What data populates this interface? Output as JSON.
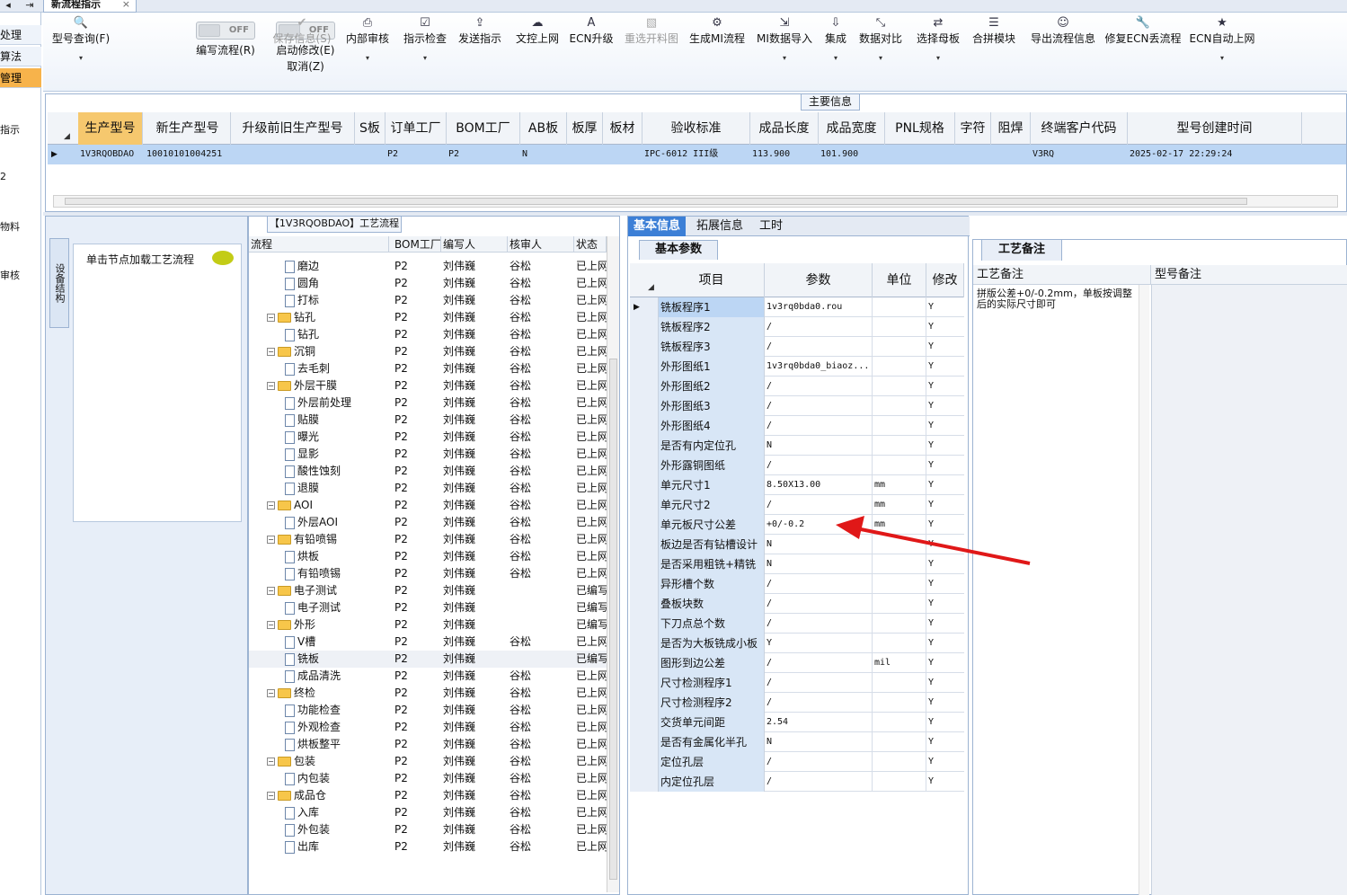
{
  "tabbar": {
    "nav_left": "◂",
    "nav_right": "⇥",
    "doc_tab": "新流程指示",
    "close": "×"
  },
  "leftnav": {
    "items": [
      {
        "label": "处理"
      },
      {
        "label": "算法"
      },
      {
        "label": "管理",
        "selected": true
      }
    ],
    "fragments": [
      "指示",
      "2",
      "物料",
      "审核"
    ]
  },
  "ribbon": {
    "buttons": [
      {
        "label": "型号查询(F)",
        "icon": "search-icon",
        "glyph": "🔍",
        "dropdown": true,
        "enabled": true
      },
      {
        "label": "保存信息(S)",
        "icon": "check-icon",
        "glyph": "✔",
        "dropdown": false,
        "enabled": false
      },
      {
        "label": "内部审核",
        "icon": "printer-icon",
        "glyph": "⎙",
        "dropdown": true,
        "enabled": true
      },
      {
        "label": "指示检查",
        "icon": "checkbox-icon",
        "glyph": "☑",
        "dropdown": true,
        "enabled": true
      },
      {
        "label": "发送指示",
        "icon": "upload-icon",
        "glyph": "⇪",
        "dropdown": false,
        "enabled": true
      },
      {
        "label": "文控上网",
        "icon": "cloud-upload-icon",
        "glyph": "☁",
        "dropdown": false,
        "enabled": true
      },
      {
        "label": "ECN升级",
        "icon": "font-icon",
        "glyph": "A",
        "dropdown": false,
        "enabled": true
      },
      {
        "label": "重选开料图",
        "icon": "image-icon",
        "glyph": "▧",
        "dropdown": false,
        "enabled": false
      },
      {
        "label": "生成MI流程",
        "icon": "cogs-icon",
        "glyph": "⚙",
        "dropdown": false,
        "enabled": true
      },
      {
        "label": "MI数据导入",
        "icon": "sign-in-icon",
        "glyph": "⇲",
        "dropdown": true,
        "enabled": true
      },
      {
        "label": "集成",
        "icon": "download-icon",
        "glyph": "⇩",
        "dropdown": true,
        "enabled": true
      },
      {
        "label": "数据对比",
        "icon": "compress-icon",
        "glyph": "⤡",
        "dropdown": true,
        "enabled": true
      },
      {
        "label": "选择母板",
        "icon": "shuffle-icon",
        "glyph": "⇄",
        "dropdown": true,
        "enabled": true
      },
      {
        "label": "合拼模块",
        "icon": "list-icon",
        "glyph": "☰",
        "dropdown": false,
        "enabled": true
      },
      {
        "label": "导出流程信息",
        "icon": "smile-icon",
        "glyph": "☺",
        "dropdown": false,
        "enabled": true
      },
      {
        "label": "修复ECN丢流程",
        "icon": "wrench-icon",
        "glyph": "🔧",
        "dropdown": false,
        "enabled": true
      },
      {
        "label": "ECN自动上网",
        "icon": "star-icon",
        "glyph": "★",
        "dropdown": true,
        "enabled": true
      }
    ],
    "toggle1": {
      "state": "OFF",
      "label": "编写流程(R)"
    },
    "toggle2": {
      "state": "OFF",
      "label": "启动修改(E)",
      "label2": "取消(Z)"
    }
  },
  "main_info": {
    "title": "主要信息",
    "columns": [
      "生产型号",
      "新生产型号",
      "升级前旧生产型号",
      "S板",
      "订单工厂",
      "BOM工厂",
      "AB板",
      "板厚",
      "板材",
      "验收标准",
      "成品长度",
      "成品宽度",
      "PNL规格",
      "字符",
      "阻焊",
      "终端客户代码",
      "型号创建时间"
    ],
    "row": [
      "1V3RQOBDAO",
      "10010101004251",
      "",
      "",
      "P2",
      "P2",
      "N",
      "",
      "",
      "IPC-6012 III级",
      "113.900",
      "101.900",
      "",
      "",
      "",
      "V3RQ",
      "2025-02-17 22:29:24"
    ]
  },
  "left_panel": {
    "vtab": "设备结构",
    "hint": "单击节点加载工艺流程"
  },
  "process": {
    "title": "【1V3RQOBDAO】工艺流程",
    "columns": [
      "流程",
      "BOM工厂",
      "编写人",
      "核审人",
      "状态"
    ],
    "rows": [
      {
        "name": "磨边",
        "level": 2,
        "type": "file",
        "factory": "P2",
        "writer": "刘伟巍",
        "reviewer": "谷松",
        "status": "已上网"
      },
      {
        "name": "圆角",
        "level": 2,
        "type": "file",
        "factory": "P2",
        "writer": "刘伟巍",
        "reviewer": "谷松",
        "status": "已上网"
      },
      {
        "name": "打标",
        "level": 2,
        "type": "file",
        "factory": "P2",
        "writer": "刘伟巍",
        "reviewer": "谷松",
        "status": "已上网"
      },
      {
        "name": "钻孔",
        "level": 1,
        "type": "folder",
        "factory": "P2",
        "writer": "刘伟巍",
        "reviewer": "谷松",
        "status": "已上网"
      },
      {
        "name": "钻孔",
        "level": 2,
        "type": "file",
        "factory": "P2",
        "writer": "刘伟巍",
        "reviewer": "谷松",
        "status": "已上网"
      },
      {
        "name": "沉铜",
        "level": 1,
        "type": "folder",
        "factory": "P2",
        "writer": "刘伟巍",
        "reviewer": "谷松",
        "status": "已上网"
      },
      {
        "name": "去毛刺",
        "level": 2,
        "type": "file",
        "factory": "P2",
        "writer": "刘伟巍",
        "reviewer": "谷松",
        "status": "已上网"
      },
      {
        "name": "外层干膜",
        "level": 1,
        "type": "folder",
        "factory": "P2",
        "writer": "刘伟巍",
        "reviewer": "谷松",
        "status": "已上网"
      },
      {
        "name": "外层前处理",
        "level": 2,
        "type": "file",
        "factory": "P2",
        "writer": "刘伟巍",
        "reviewer": "谷松",
        "status": "已上网"
      },
      {
        "name": "贴膜",
        "level": 2,
        "type": "file",
        "factory": "P2",
        "writer": "刘伟巍",
        "reviewer": "谷松",
        "status": "已上网"
      },
      {
        "name": "曝光",
        "level": 2,
        "type": "file",
        "factory": "P2",
        "writer": "刘伟巍",
        "reviewer": "谷松",
        "status": "已上网"
      },
      {
        "name": "显影",
        "level": 2,
        "type": "file",
        "factory": "P2",
        "writer": "刘伟巍",
        "reviewer": "谷松",
        "status": "已上网"
      },
      {
        "name": "酸性蚀刻",
        "level": 2,
        "type": "file",
        "factory": "P2",
        "writer": "刘伟巍",
        "reviewer": "谷松",
        "status": "已上网"
      },
      {
        "name": "退膜",
        "level": 2,
        "type": "file",
        "factory": "P2",
        "writer": "刘伟巍",
        "reviewer": "谷松",
        "status": "已上网"
      },
      {
        "name": "AOI",
        "level": 1,
        "type": "folder",
        "factory": "P2",
        "writer": "刘伟巍",
        "reviewer": "谷松",
        "status": "已上网"
      },
      {
        "name": "外层AOI",
        "level": 2,
        "type": "file",
        "factory": "P2",
        "writer": "刘伟巍",
        "reviewer": "谷松",
        "status": "已上网"
      },
      {
        "name": "有铅喷锡",
        "level": 1,
        "type": "folder",
        "factory": "P2",
        "writer": "刘伟巍",
        "reviewer": "谷松",
        "status": "已上网"
      },
      {
        "name": "烘板",
        "level": 2,
        "type": "file",
        "factory": "P2",
        "writer": "刘伟巍",
        "reviewer": "谷松",
        "status": "已上网"
      },
      {
        "name": "有铅喷锡",
        "level": 2,
        "type": "file",
        "factory": "P2",
        "writer": "刘伟巍",
        "reviewer": "谷松",
        "status": "已上网"
      },
      {
        "name": "电子测试",
        "level": 1,
        "type": "folder",
        "factory": "P2",
        "writer": "刘伟巍",
        "reviewer": "",
        "status": "已编写"
      },
      {
        "name": "电子测试",
        "level": 2,
        "type": "file",
        "factory": "P2",
        "writer": "刘伟巍",
        "reviewer": "",
        "status": "已编写"
      },
      {
        "name": "外形",
        "level": 1,
        "type": "folder",
        "factory": "P2",
        "writer": "刘伟巍",
        "reviewer": "",
        "status": "已编写"
      },
      {
        "name": "V槽",
        "level": 2,
        "type": "file",
        "factory": "P2",
        "writer": "刘伟巍",
        "reviewer": "谷松",
        "status": "已上网"
      },
      {
        "name": "铣板",
        "level": 2,
        "type": "file",
        "factory": "P2",
        "writer": "刘伟巍",
        "reviewer": "",
        "status": "已编写",
        "selected": true
      },
      {
        "name": "成品清洗",
        "level": 2,
        "type": "file",
        "factory": "P2",
        "writer": "刘伟巍",
        "reviewer": "谷松",
        "status": "已上网"
      },
      {
        "name": "终检",
        "level": 1,
        "type": "folder",
        "factory": "P2",
        "writer": "刘伟巍",
        "reviewer": "谷松",
        "status": "已上网"
      },
      {
        "name": "功能检查",
        "level": 2,
        "type": "file",
        "factory": "P2",
        "writer": "刘伟巍",
        "reviewer": "谷松",
        "status": "已上网"
      },
      {
        "name": "外观检查",
        "level": 2,
        "type": "file",
        "factory": "P2",
        "writer": "刘伟巍",
        "reviewer": "谷松",
        "status": "已上网"
      },
      {
        "name": "烘板整平",
        "level": 2,
        "type": "file",
        "factory": "P2",
        "writer": "刘伟巍",
        "reviewer": "谷松",
        "status": "已上网"
      },
      {
        "name": "包装",
        "level": 1,
        "type": "folder",
        "factory": "P2",
        "writer": "刘伟巍",
        "reviewer": "谷松",
        "status": "已上网"
      },
      {
        "name": "内包装",
        "level": 2,
        "type": "file",
        "factory": "P2",
        "writer": "刘伟巍",
        "reviewer": "谷松",
        "status": "已上网"
      },
      {
        "name": "成品仓",
        "level": 1,
        "type": "folder",
        "factory": "P2",
        "writer": "刘伟巍",
        "reviewer": "谷松",
        "status": "已上网"
      },
      {
        "name": "入库",
        "level": 2,
        "type": "file",
        "factory": "P2",
        "writer": "刘伟巍",
        "reviewer": "谷松",
        "status": "已上网"
      },
      {
        "name": "外包装",
        "level": 2,
        "type": "file",
        "factory": "P2",
        "writer": "刘伟巍",
        "reviewer": "谷松",
        "status": "已上网"
      },
      {
        "name": "出库",
        "level": 2,
        "type": "file",
        "factory": "P2",
        "writer": "刘伟巍",
        "reviewer": "谷松",
        "status": "已上网"
      }
    ]
  },
  "detail": {
    "tabs": [
      "基本信息",
      "拓展信息",
      "工时"
    ],
    "subtab": "基本参数",
    "columns": [
      "项目",
      "参数",
      "单位",
      "修改"
    ],
    "rows": [
      {
        "item": "铣板程序1",
        "param": "1v3rq0bda0.rou",
        "unit": "",
        "mod": "Y",
        "selected": true
      },
      {
        "item": "铣板程序2",
        "param": "/",
        "unit": "",
        "mod": "Y"
      },
      {
        "item": "铣板程序3",
        "param": "/",
        "unit": "",
        "mod": "Y"
      },
      {
        "item": "外形图纸1",
        "param": "1v3rq0bda0_biaoz...",
        "unit": "",
        "mod": "Y"
      },
      {
        "item": "外形图纸2",
        "param": "/",
        "unit": "",
        "mod": "Y"
      },
      {
        "item": "外形图纸3",
        "param": "/",
        "unit": "",
        "mod": "Y"
      },
      {
        "item": "外形图纸4",
        "param": "/",
        "unit": "",
        "mod": "Y"
      },
      {
        "item": "是否有内定位孔",
        "param": "N",
        "unit": "",
        "mod": "Y"
      },
      {
        "item": "外形露铜图纸",
        "param": "/",
        "unit": "",
        "mod": "Y"
      },
      {
        "item": "单元尺寸1",
        "param": "8.50X13.00",
        "unit": "mm",
        "mod": "Y"
      },
      {
        "item": "单元尺寸2",
        "param": "/",
        "unit": "mm",
        "mod": "Y"
      },
      {
        "item": "单元板尺寸公差",
        "param": "+0/-0.2",
        "unit": "mm",
        "mod": "Y"
      },
      {
        "item": "板边是否有钻槽设计",
        "param": "N",
        "unit": "",
        "mod": "Y"
      },
      {
        "item": "是否采用粗铣+精铣",
        "param": "N",
        "unit": "",
        "mod": "Y"
      },
      {
        "item": "异形槽个数",
        "param": "/",
        "unit": "",
        "mod": "Y"
      },
      {
        "item": "叠板块数",
        "param": "/",
        "unit": "",
        "mod": "Y"
      },
      {
        "item": "下刀点总个数",
        "param": "/",
        "unit": "",
        "mod": "Y"
      },
      {
        "item": "是否为大板铣成小板",
        "param": "Y",
        "unit": "",
        "mod": "Y"
      },
      {
        "item": "图形到边公差",
        "param": "/",
        "unit": "mil",
        "mod": "Y"
      },
      {
        "item": "尺寸检测程序1",
        "param": "/",
        "unit": "",
        "mod": "Y"
      },
      {
        "item": "尺寸检测程序2",
        "param": "/",
        "unit": "",
        "mod": "Y"
      },
      {
        "item": "交货单元间距",
        "param": "2.54",
        "unit": "",
        "mod": "Y"
      },
      {
        "item": "是否有金属化半孔",
        "param": "N",
        "unit": "",
        "mod": "Y"
      },
      {
        "item": "定位孔层",
        "param": "/",
        "unit": "",
        "mod": "Y"
      },
      {
        "item": "内定位孔层",
        "param": "/",
        "unit": "",
        "mod": "Y"
      }
    ]
  },
  "notes": {
    "tab": "工艺备注",
    "col1": "工艺备注",
    "col2": "型号备注",
    "text": "拼版公差+0/-0.2mm，单板按调整后的实际尺寸即可"
  },
  "colors": {
    "accent": "#3c7fd6",
    "selected_header": "#f6c86e",
    "selected_row": "#bcd6f4",
    "arrow": "#e01818"
  }
}
